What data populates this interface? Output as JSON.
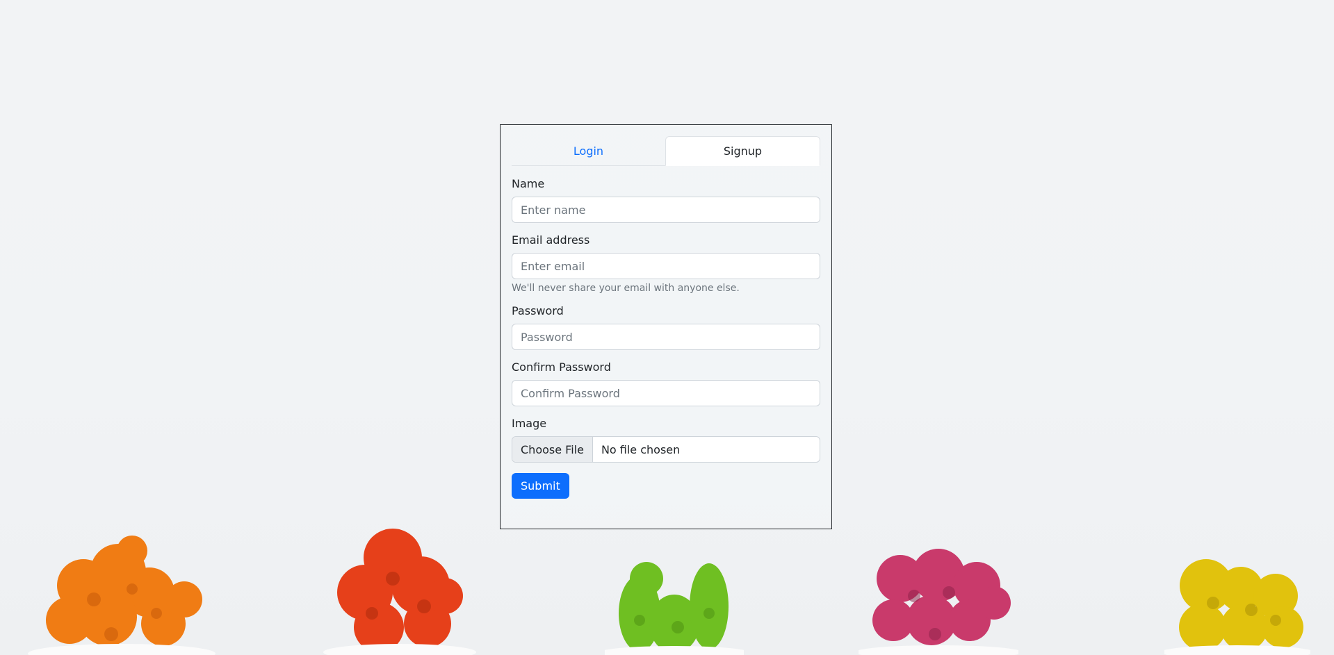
{
  "tabs": {
    "login": "Login",
    "signup": "Signup"
  },
  "form": {
    "name": {
      "label": "Name",
      "placeholder": "Enter name"
    },
    "email": {
      "label": "Email address",
      "placeholder": "Enter email",
      "help": "We'll never share your email with anyone else."
    },
    "password": {
      "label": "Password",
      "placeholder": "Password"
    },
    "confirm": {
      "label": "Confirm Password",
      "placeholder": "Confirm Password"
    },
    "image": {
      "label": "Image",
      "button": "Choose File",
      "status": "No file chosen"
    },
    "submit": "Submit"
  },
  "colors": {
    "accent": "#0d6efd",
    "cactus_orange": "#f07c14",
    "cactus_red": "#e6401a",
    "cactus_green": "#6fbf22",
    "cactus_pink": "#c93a6b",
    "cactus_yellow": "#e1c20d"
  },
  "decor": [
    "orange-cactus",
    "red-cactus",
    "green-cactus",
    "pink-cactus",
    "yellow-cactus"
  ]
}
